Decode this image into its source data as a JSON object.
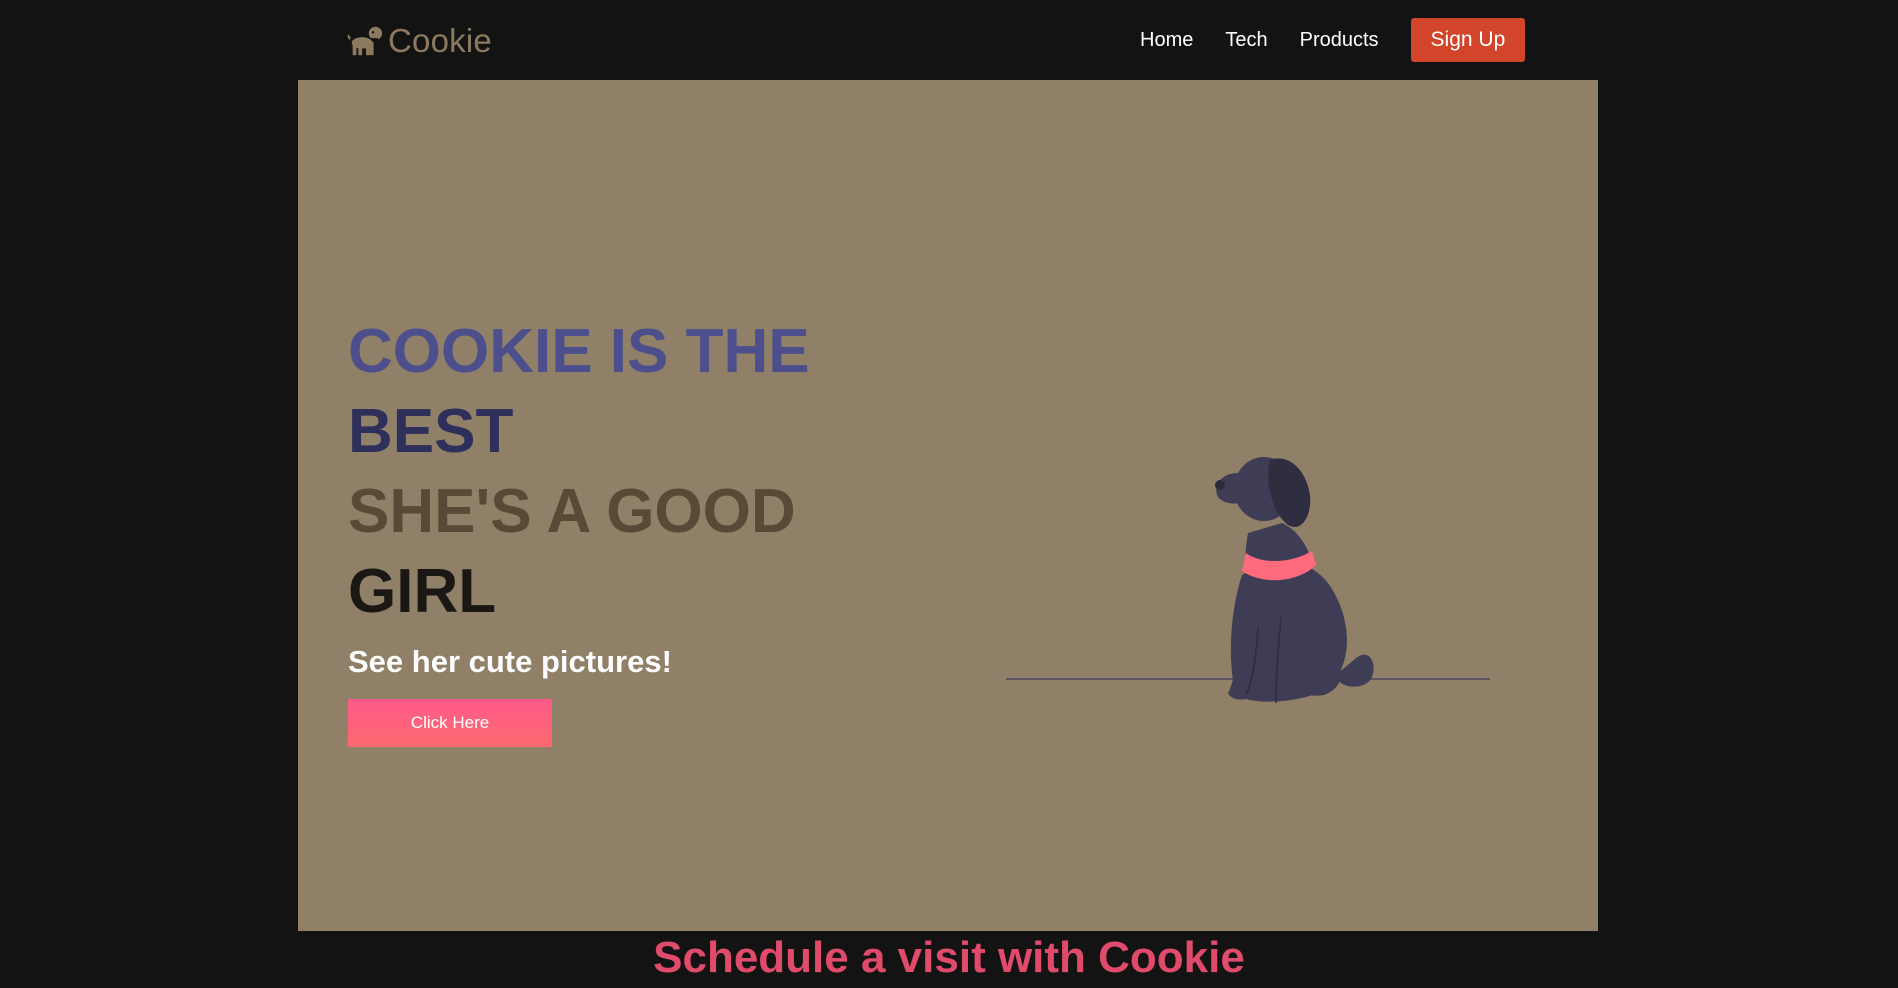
{
  "brand": {
    "name": "Cookie",
    "icon": "dog-icon",
    "color": "#8c7a5f"
  },
  "nav": {
    "links": [
      {
        "label": "Home"
      },
      {
        "label": "Tech"
      },
      {
        "label": "Products"
      }
    ],
    "signup_label": "Sign Up"
  },
  "hero": {
    "heading_lines": [
      "COOKIE IS THE",
      "BEST",
      "SHE'S A GOOD",
      "GIRL"
    ],
    "subheading": "See her cute pictures!",
    "button_label": "Click Here",
    "illustration": "sitting-dog-illustration"
  },
  "next_section": {
    "title": "Schedule a visit with Cookie"
  },
  "colors": {
    "background": "#131313",
    "hero_background": "#8f8067",
    "signup_button": "#d2452a",
    "cta_gradient_start": "#ff5a8a",
    "cta_gradient_end": "#fd6a70",
    "dog_body": "#3f3d56",
    "dog_collar": "#ff6b7d"
  }
}
